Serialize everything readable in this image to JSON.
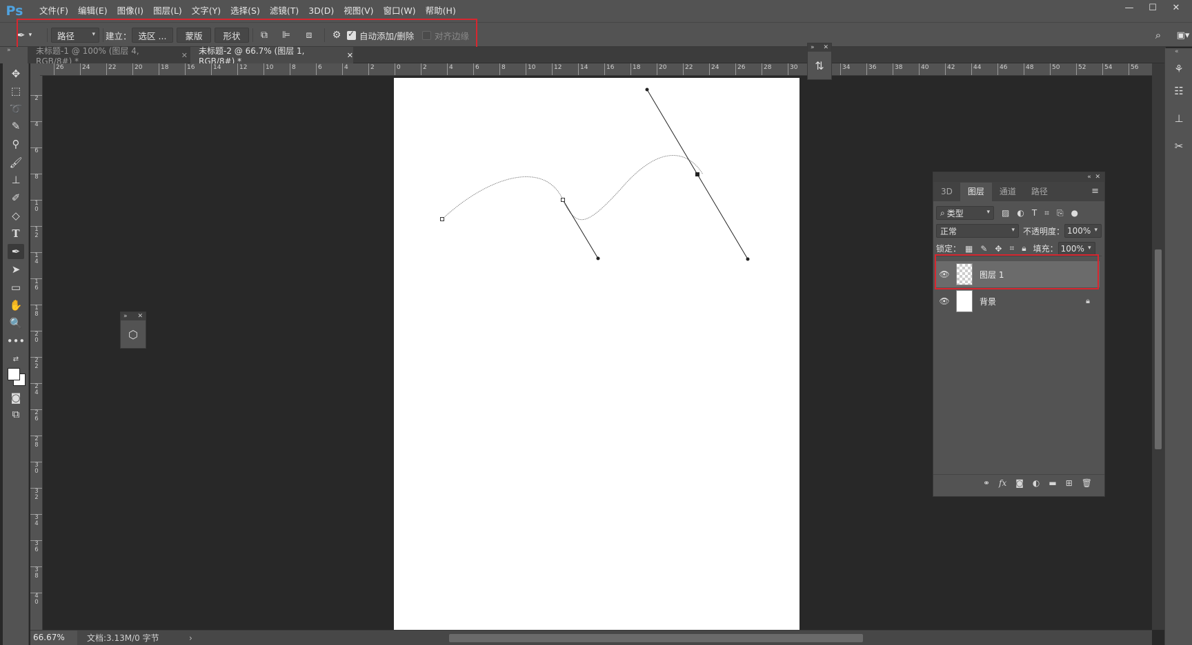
{
  "app": {
    "logo": "Ps",
    "menu": [
      "文件(F)",
      "编辑(E)",
      "图像(I)",
      "图层(L)",
      "文字(Y)",
      "选择(S)",
      "滤镜(T)",
      "3D(D)",
      "视图(V)",
      "窗口(W)",
      "帮助(H)"
    ],
    "window_controls": [
      "—",
      "☐",
      "✕"
    ]
  },
  "options": {
    "tool_icon": "pen-icon",
    "mode_select": "路径",
    "make_label": "建立：",
    "selection_btn": "选区 ...",
    "mask_btn": "蒙版",
    "shape_btn": "形状",
    "auto_add_delete": "自动添加/删除",
    "auto_add_delete_checked": true,
    "align_edges": "对齐边缘",
    "align_edges_checked": false
  },
  "tabs": [
    {
      "title": "未标题-1 @ 100% (图层 4, RGB/8#) *",
      "active": false
    },
    {
      "title": "未标题-2 @ 66.7% (图层 1, RGB/8#) *",
      "active": true
    }
  ],
  "rulers": {
    "h": [
      "26",
      "24",
      "22",
      "20",
      "18",
      "16",
      "14",
      "12",
      "10",
      "8",
      "6",
      "4",
      "2",
      "0",
      "2",
      "4",
      "6",
      "8",
      "10",
      "12",
      "14",
      "16",
      "18",
      "20",
      "22",
      "24",
      "26",
      "28",
      "30",
      "32",
      "34",
      "36",
      "38",
      "40",
      "42",
      "44",
      "46",
      "48",
      "50",
      "52",
      "54",
      "56"
    ],
    "v": [
      "2",
      "4",
      "6",
      "8",
      "10",
      "12",
      "14",
      "16",
      "18",
      "20",
      "22",
      "24",
      "26",
      "28",
      "30",
      "32",
      "34",
      "36",
      "38",
      "40"
    ]
  },
  "status": {
    "zoom": "66.67%",
    "doc_info": "文档:3.13M/0 字节",
    "arrow": "›"
  },
  "layers_panel": {
    "tabs": [
      "3D",
      "图层",
      "通道",
      "路径"
    ],
    "active_tab": "图层",
    "filter_label": "类型",
    "blend_mode": "正常",
    "opacity_label": "不透明度：",
    "opacity_value": "100%",
    "lock_label": "锁定：",
    "fill_label": "填充：",
    "fill_value": "100%",
    "layers": [
      {
        "name": "图层 1",
        "thumb": "transparent",
        "selected": true,
        "locked": false
      },
      {
        "name": "背景",
        "thumb": "white",
        "selected": false,
        "locked": true
      }
    ]
  },
  "colors": {
    "highlight_box": "#d8262f",
    "ps_blue": "#4fa3e0"
  }
}
